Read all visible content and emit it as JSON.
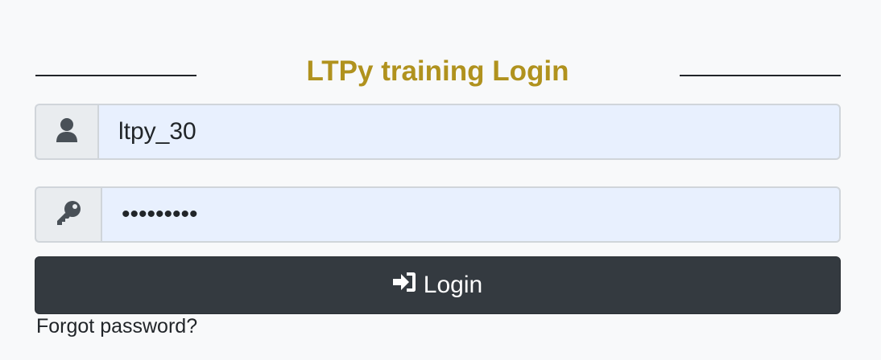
{
  "login": {
    "title": "LTPy training Login",
    "username_value": "ltpy_30",
    "password_value": "•••••••••",
    "login_label": "Login",
    "forgot_label": "Forgot password?"
  },
  "icons": {
    "user": "user-icon",
    "password": "key-icon",
    "login": "sign-in-icon"
  },
  "colors": {
    "title": "#b0921e",
    "button": "#343a40",
    "input_bg": "#e8f0fe",
    "addon_bg": "#e9ecef",
    "page_bg": "#f8f9fa"
  }
}
